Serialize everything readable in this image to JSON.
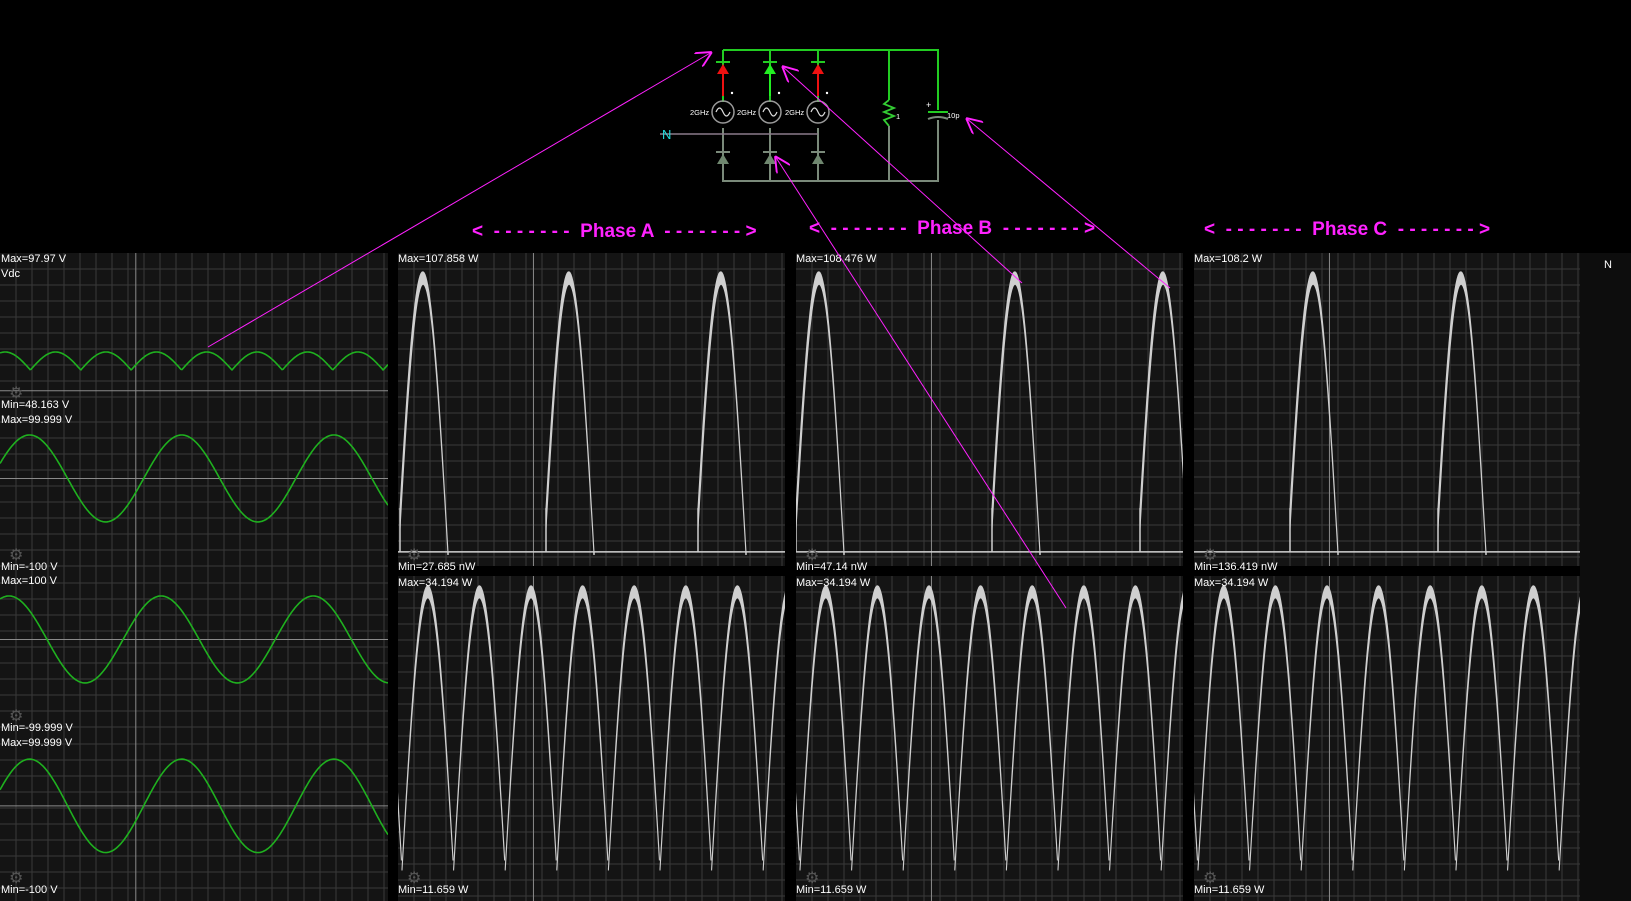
{
  "circuit": {
    "source_labels": [
      "2GHz",
      "2GHz",
      "2GHz"
    ],
    "resistor_label": "1",
    "capacitor_label": "10pF",
    "neutral_label": "N"
  },
  "phase_headers": {
    "a": "<  - - - - - - -  Phase A  - - - - - - - >",
    "b": "<  - - - - - - -  Phase B  - - - - - - - >",
    "c": "<  - - - - - - -  Phase C  - - - - - - - >"
  },
  "side_label": "N",
  "scopes": {
    "vdc": {
      "max": "Max=97.97 V",
      "name": "Vdc",
      "min": "Min=48.163 V"
    },
    "v1": {
      "max": "Max=99.999 V",
      "min": "Min=-100 V"
    },
    "v2": {
      "max": "Max=100 V",
      "min": "Min=-99.999 V"
    },
    "v3": {
      "max": "Max=99.999 V",
      "min": "Min=-100 V"
    },
    "pa_top": {
      "max": "Max=107.858 W",
      "min": "Min=27.685 nW"
    },
    "pb_top": {
      "max": "Max=108.476 W",
      "min": "Min=47.14 nW"
    },
    "pc_top": {
      "max": "Max=108.2 W",
      "min": "Min=136.419 nW"
    },
    "pa_bot": {
      "max": "Max=34.194 W",
      "min": "Min=11.659 W"
    },
    "pb_bot": {
      "max": "Max=34.194 W",
      "min": "Min=11.659 W"
    },
    "pc_bot": {
      "max": "Max=34.194 W",
      "min": "Min=11.659 W"
    }
  },
  "colors": {
    "trace_green": "#1fb01f",
    "trace_gray": "#cfcfcf",
    "grid": "#3a3a3a",
    "axis": "#8a8a8a",
    "annotation": "#ff22ff",
    "wire_green": "#22cc22",
    "wire_gray": "#7a8a7a"
  }
}
